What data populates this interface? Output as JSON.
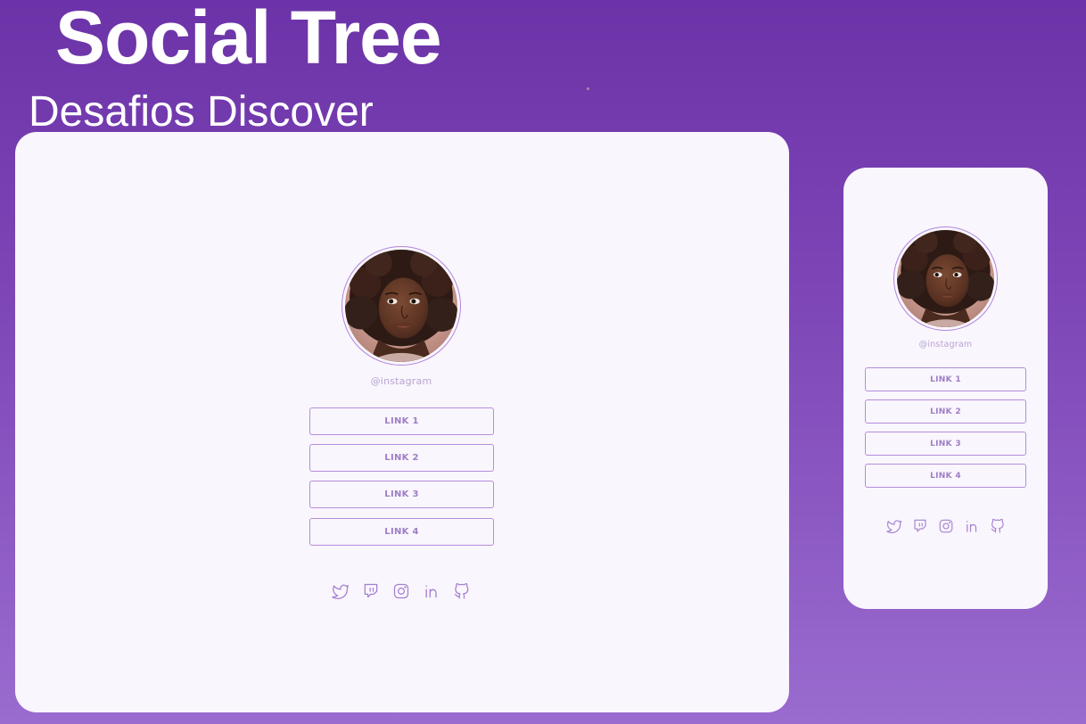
{
  "header": {
    "title": "Social Tree",
    "subtitle": "Desafios Discover"
  },
  "profile": {
    "handle": "@instagram",
    "avatar": "avatar-photo"
  },
  "links": [
    {
      "label": "LINK 1"
    },
    {
      "label": "LINK 2"
    },
    {
      "label": "LINK 3"
    },
    {
      "label": "LINK 4"
    }
  ],
  "social_icons": [
    "twitter-icon",
    "twitch-icon",
    "instagram-icon",
    "linkedin-icon",
    "github-icon"
  ],
  "colors": {
    "background_top": "#6c33a8",
    "background_bottom": "#9a6ccf",
    "card": "#f9f6fd",
    "accent": "#b58ddc",
    "link_text": "#9f7dc6",
    "handle_text": "#b9a3d2"
  }
}
